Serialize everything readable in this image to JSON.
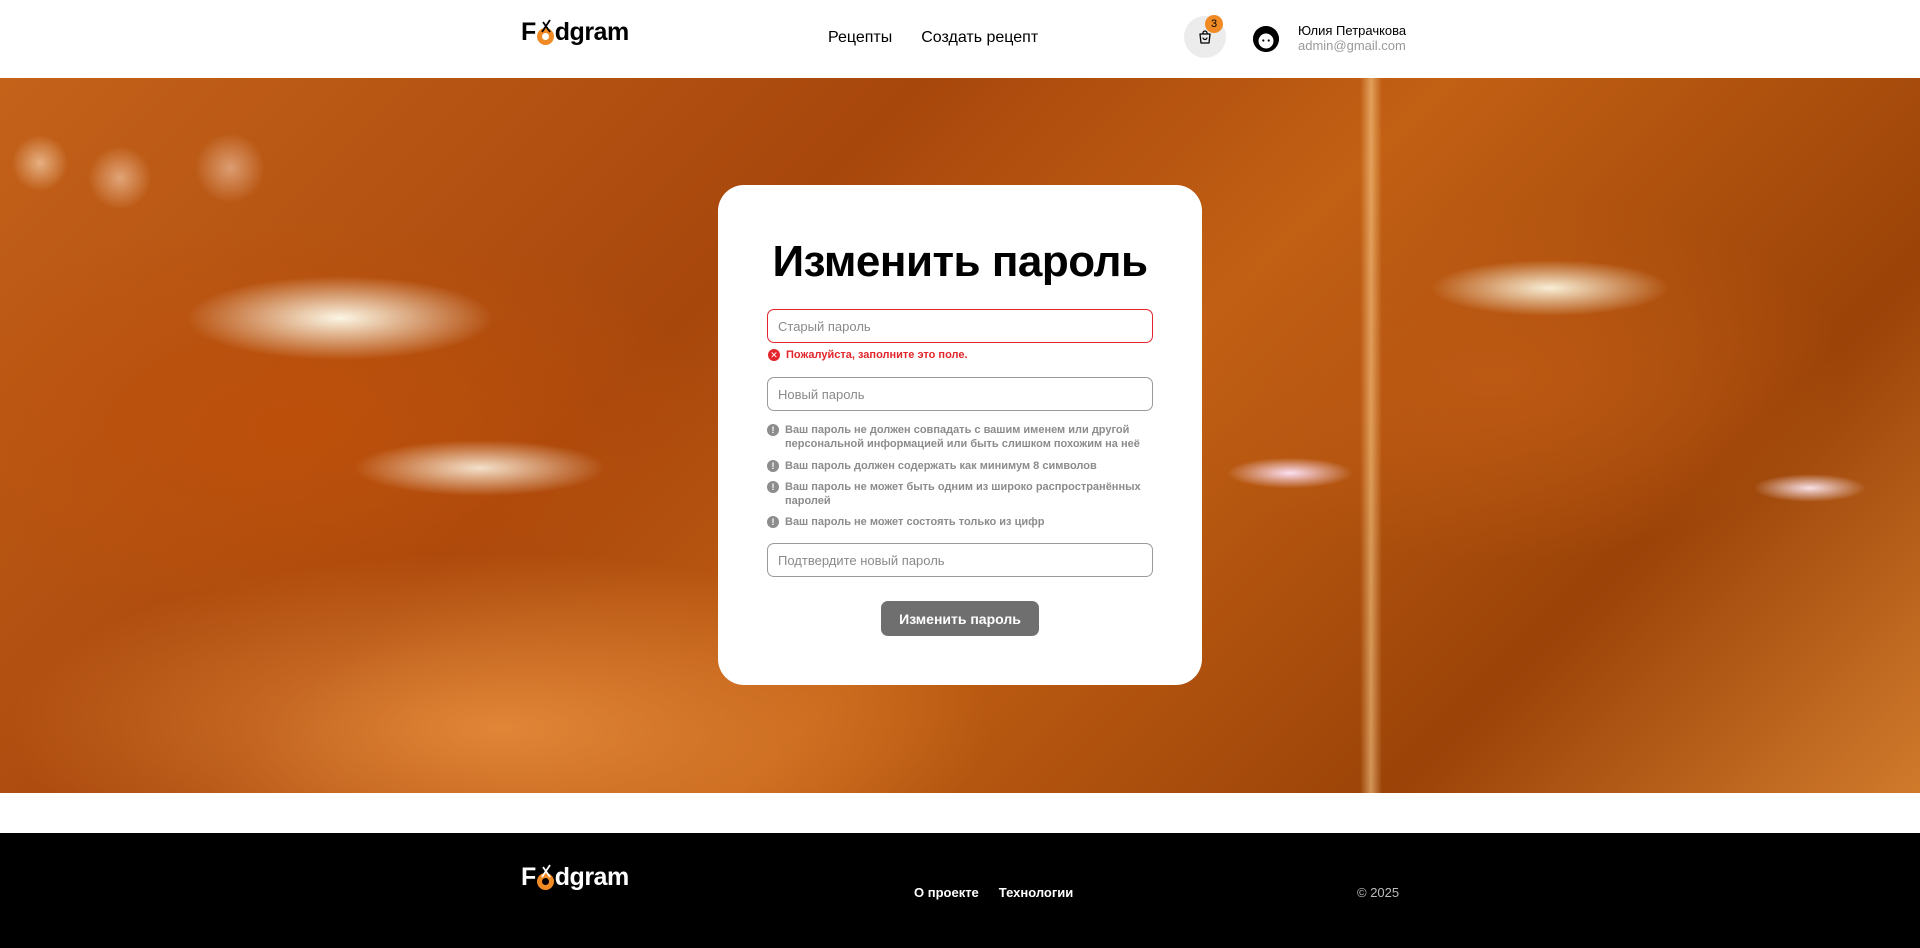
{
  "brand": {
    "logo_before": "F",
    "logo_after": "dgram",
    "accent": "#f08a24"
  },
  "header": {
    "nav": [
      {
        "label": "Рецепты"
      },
      {
        "label": "Создать рецепт"
      }
    ],
    "cart": {
      "icon": "cart-icon",
      "count": "3"
    },
    "user": {
      "name": "Юлия Петрачкова",
      "email": "admin@gmail.com",
      "avatar_icon": "avatar-icon"
    }
  },
  "form": {
    "title": "Изменить пароль",
    "old_password": {
      "placeholder": "Старый пароль",
      "value": ""
    },
    "old_password_error": "Пожалуйста, заполните это поле.",
    "new_password": {
      "placeholder": "Новый пароль",
      "value": ""
    },
    "hints": [
      "Ваш пароль не должен совпадать с вашим именем или другой персональной информацией или быть слишком похожим на неё",
      "Ваш пароль должен содержать как минимум 8 символов",
      "Ваш пароль не может быть одним из широко распространённых паролей",
      "Ваш пароль не может состоять только из цифр"
    ],
    "confirm_password": {
      "placeholder": "Подтвердите новый пароль",
      "value": ""
    },
    "submit_label": "Изменить пароль",
    "error_color": "#e2262b"
  },
  "footer": {
    "nav": [
      {
        "label": "О проекте"
      },
      {
        "label": "Технологии"
      }
    ],
    "copyright": "© 2025"
  }
}
